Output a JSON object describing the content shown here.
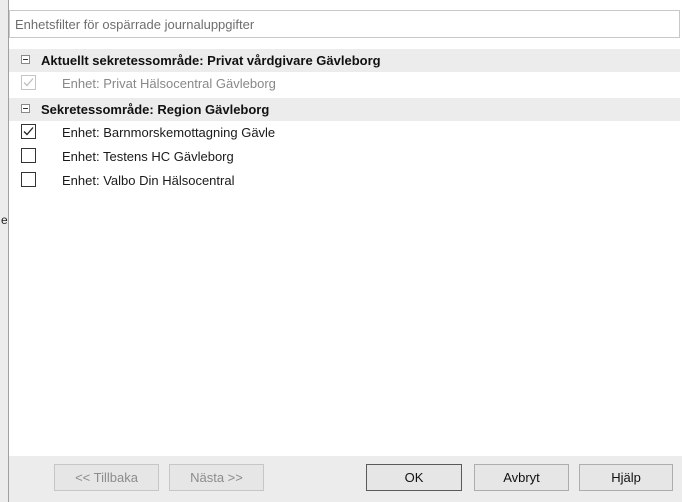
{
  "dialog": {
    "title": "Enhetsfilter för ospärrade journaluppgifter"
  },
  "left_stub": "el",
  "groups": [
    {
      "label": "Aktuellt sekretessområde: Privat vårdgivare Gävleborg",
      "items": [
        {
          "label": "Enhet: Privat Hälsocentral Gävleborg",
          "checked": true,
          "disabled": true
        }
      ]
    },
    {
      "label": "Sekretessområde: Region Gävleborg",
      "items": [
        {
          "label": "Enhet: Barnmorskemottagning Gävle",
          "checked": true,
          "disabled": false
        },
        {
          "label": "Enhet: Testens HC Gävleborg",
          "checked": false,
          "disabled": false
        },
        {
          "label": "Enhet: Valbo Din Hälsocentral",
          "checked": false,
          "disabled": false
        }
      ]
    }
  ],
  "buttons": {
    "back": "<< Tillbaka",
    "next": "Nästa >>",
    "ok": "OK",
    "cancel": "Avbryt",
    "help": "Hjälp"
  },
  "colors": {
    "group_background": "#ececec",
    "footer_background": "#ececec",
    "disabled_text": "#888888"
  },
  "icons": [
    "collapse-icon",
    "checkbox-checked-icon",
    "checkbox-unchecked-icon"
  ]
}
